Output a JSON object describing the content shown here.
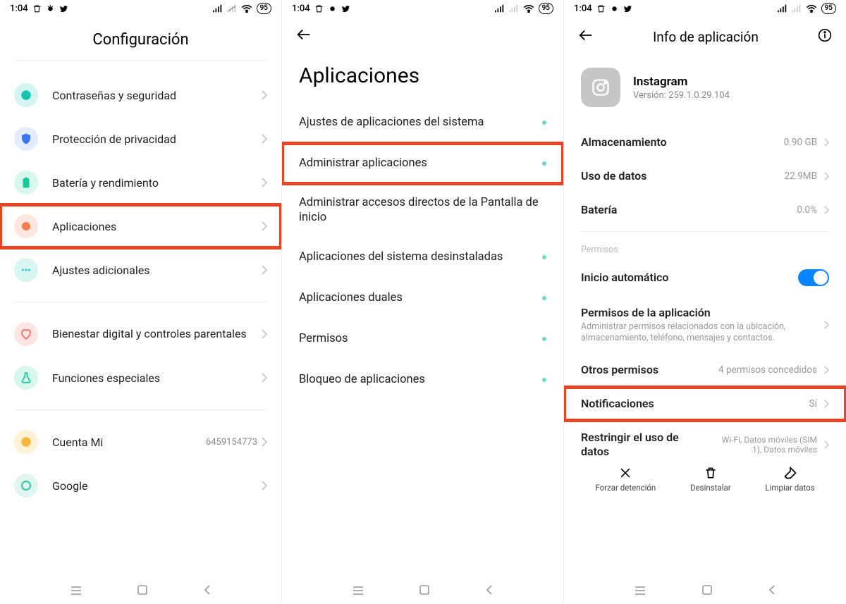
{
  "status": {
    "time": "1:04",
    "battery": "95"
  },
  "s1": {
    "title": "Configuración",
    "items": {
      "passwords": "Contraseñas y seguridad",
      "privacy": "Protección de privacidad",
      "battery": "Batería y rendimiento",
      "apps": "Aplicaciones",
      "additional": "Ajustes adicionales",
      "wellbeing": "Bienestar digital y controles parentales",
      "special": "Funciones especiales",
      "mi_account": "Cuenta Mi",
      "mi_value": "6459154773",
      "google": "Google"
    }
  },
  "s2": {
    "title": "Aplicaciones",
    "items": {
      "system": "Ajustes de aplicaciones del sistema",
      "manage": "Administrar aplicaciones",
      "shortcuts": "Administrar accesos directos de la Pantalla de inicio",
      "uninstalled": "Aplicaciones del sistema desinstaladas",
      "dual": "Aplicaciones duales",
      "perms": "Permisos",
      "lock": "Bloqueo de aplicaciones"
    }
  },
  "s3": {
    "title": "Info de aplicación",
    "app_name": "Instagram",
    "version_label": "Versión: 259.1.0.29.104",
    "storage": {
      "label": "Almacenamiento",
      "value": "0.90 GB"
    },
    "data": {
      "label": "Uso de datos",
      "value": "22.9MB"
    },
    "battery": {
      "label": "Batería",
      "value": "0.0%"
    },
    "perms_section": "Permisos",
    "autostart": "Inicio automático",
    "app_perms": {
      "label": "Permisos de la aplicación",
      "desc": "Administrar permisos relacionados con la ubicación, almacenamiento, teléfono, mensajes y contactos."
    },
    "other_perms": {
      "label": "Otros permisos",
      "value": "4 permisos concedidos"
    },
    "notifications": {
      "label": "Notificaciones",
      "value": "Sí"
    },
    "restrict": {
      "label": "Restringir el uso de datos",
      "value": "Wi-Fi, Datos móviles (SIM 1), Datos móviles"
    },
    "actions": {
      "force_stop": "Forzar detención",
      "uninstall": "Desinstalar",
      "clear": "Limpiar datos"
    }
  }
}
